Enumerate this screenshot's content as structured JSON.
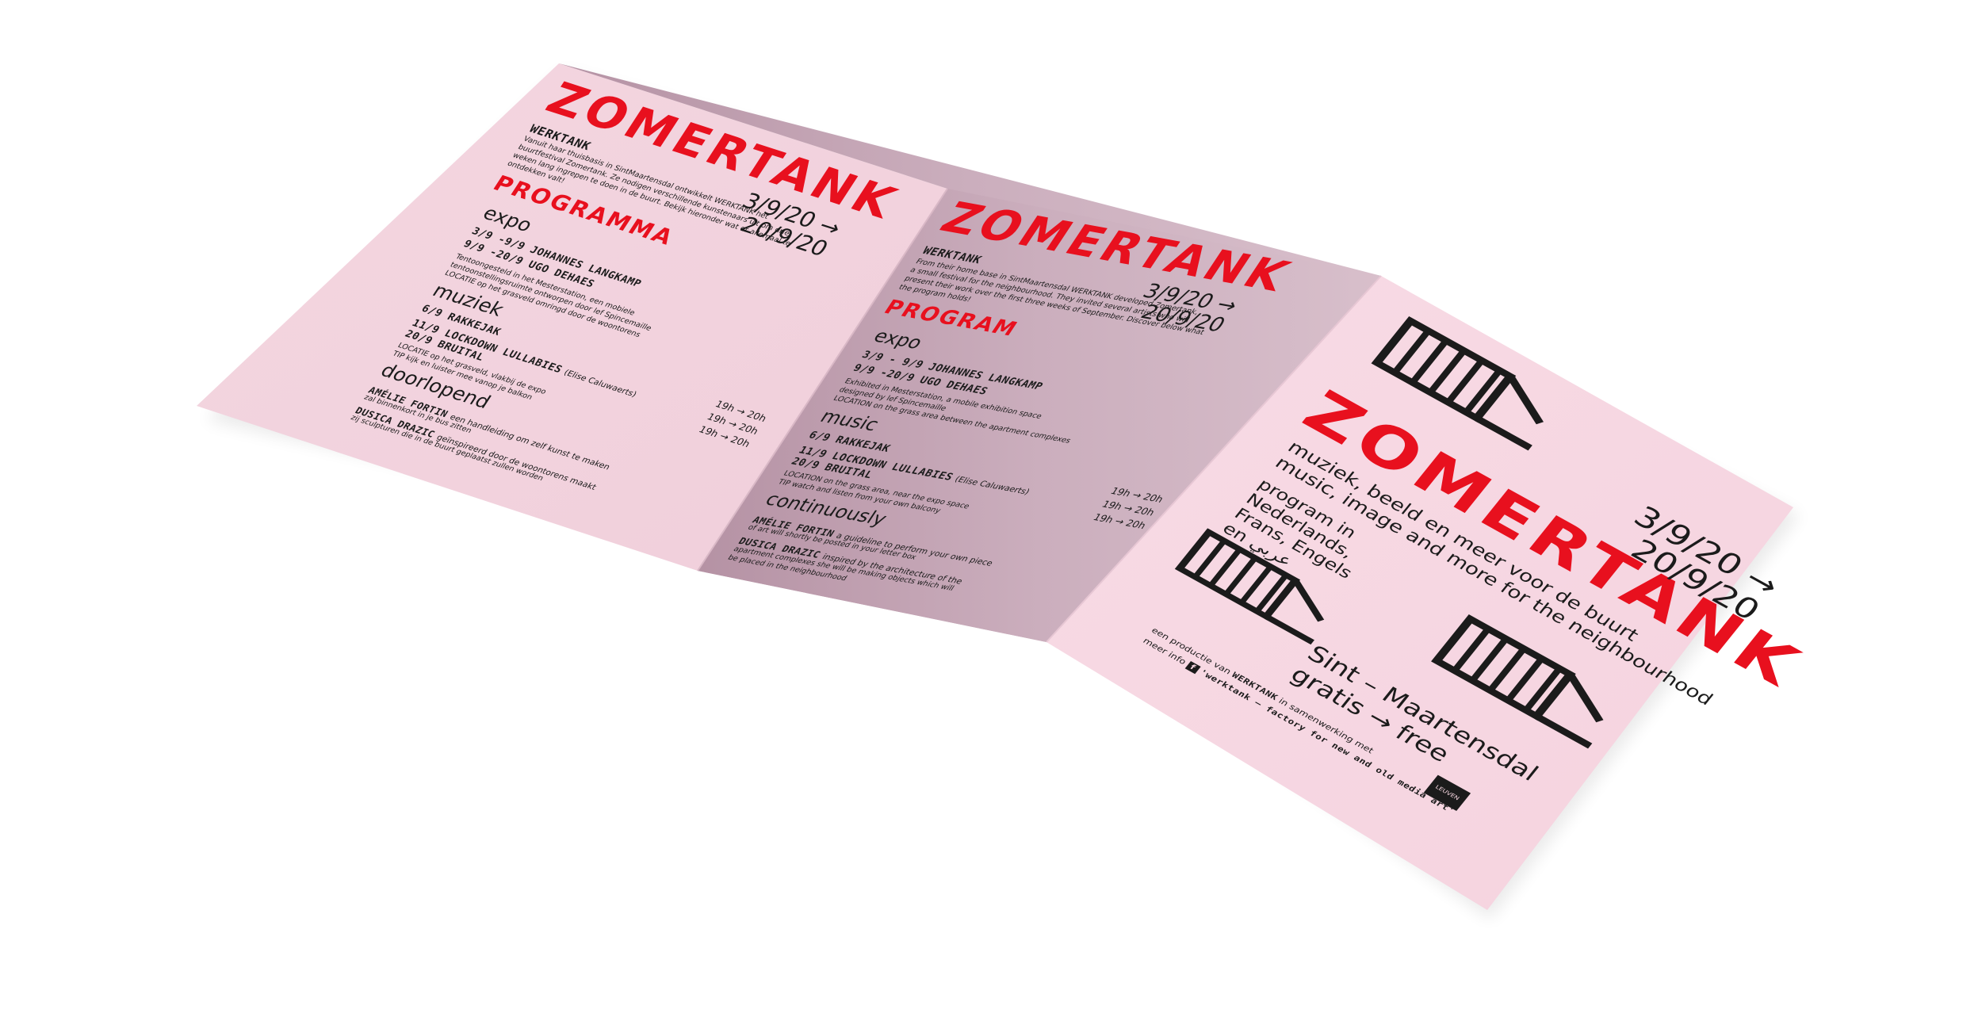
{
  "flyer": {
    "colors": {
      "paper_light": "#f6d6e0",
      "paper_shadow": "#c9a9b7",
      "accent_red": "#e8101e",
      "ink": "#1b1b1b"
    },
    "left_panel": {
      "title": "ZOMERTANK",
      "dates_start": "3/9/20 →",
      "dates_end": "20/9/20",
      "org": "WERKTANK",
      "intro": [
        "Vanuit haar thuisbasis in SintMaartensdal ontwikkelt WERKTANK het",
        "buurtfestival Zomertank. Ze nodigen verschillende kunstenaars uit om drie",
        "weken lang ingrepen te doen in de buurt. Bekijk hieronder wat er allemaal te",
        "ontdekken valt!"
      ],
      "heading": "PROGRAMMA",
      "expo_label": "expo",
      "expo_item": "3/9 -9/9 JOHANNES LANGKAMP",
      "expo_item2": "9/9 -20/9 UGO DEHAES",
      "expo_desc": [
        "Tentoongesteld in het Mesterstation, een mobiele",
        "tentoonstellingsruimte ontworpen door lef Spincemaille",
        "LOCATIE op het grasveld omringd door de woontorens"
      ],
      "music_label": "muziek",
      "music_1": "6/9 RAKKEJAK",
      "music_2": "11/9 LOCKDOWN LULLABIES",
      "music_2_note": "(Elise Caluwaerts)",
      "music_3": "20/9 BRUITAL",
      "music_desc": [
        "LOCATIE op het grasveld, vlakbij de expo",
        "TIP kijk en luister mee vanop je balkon"
      ],
      "times": [
        "19h → 20h",
        "19h → 20h",
        "19h → 20h"
      ],
      "ongoing_label": "doorlopend",
      "ongoing_1": "AMÉLIE FORTIN",
      "ongoing_1_desc": "een handleiding om zelf kunst te maken",
      "ongoing_1_desc2": "zal binnenkort in je bus zitten",
      "ongoing_2": "DUSICA DRAZIC",
      "ongoing_2_desc": "geïnspireerd door de woontorens maakt",
      "ongoing_2_desc2": "zij sculpturen die in de buurt geplaatst zullen worden"
    },
    "middle_panel": {
      "title": "ZOMERTANK",
      "dates_start": "3/9/20 →",
      "dates_end": "20/9/20",
      "org": "WERKTANK",
      "intro": [
        "From their home base in SintMaartensdal WERKTANK developed Zomertank,",
        "a small festival for the neighbourhood. They invited several artists who will",
        "present their work over the first three weeks of September. Discover below what",
        "the program holds!"
      ],
      "heading": "PROGRAM",
      "expo_label": "expo",
      "expo_item": "3/9 - 9/9 JOHANNES LANGKAMP",
      "expo_item2": "9/9 -20/9 UGO DEHAES",
      "expo_desc": [
        "Exhibited in Mesterstation, a mobile exhibition space",
        "designed by lef Spincemaille",
        "LOCATION on the grass area between the apartment complexes"
      ],
      "music_label": "music",
      "music_1": "6/9 RAKKEJAK",
      "music_2": "11/9 LOCKDOWN LULLABIES",
      "music_2_note": "(Elise Caluwaerts)",
      "music_3": "20/9 BRUITAL",
      "music_desc": [
        "LOCATION on the grass area, near the expo space",
        "TIP watch and listen from your own balcony"
      ],
      "times": [
        "19h → 20h",
        "19h → 20h",
        "19h → 20h"
      ],
      "ongoing_label": "continuously",
      "ongoing_1": "AMÉLIE FORTIN",
      "ongoing_1_desc": "a guideline to perform your own piece",
      "ongoing_1_desc2": "of art will shortly be posted in your letter box",
      "ongoing_2": "DUSICA DRAZIC",
      "ongoing_2_desc": "inspired by the architecture of the",
      "ongoing_2_desc2": "apartment complexes she will be making objects which will",
      "ongoing_2_desc3": "be placed in the neighbourhood"
    },
    "right_panel": {
      "title": "ZOMERTANK",
      "dates_start": "3/9/20 →",
      "dates_end": "20/9/20",
      "tagline_nl": "muziek, beeld en meer voor de buurt",
      "tagline_en": "music, image and more for the neighbourhood",
      "languages": [
        "program in",
        "Nederlands,",
        "Frans, Engels",
        "en عربي"
      ],
      "location": "Sint – Maartensdal",
      "price": "gratis → free",
      "credit_prefix": "een productie van",
      "credit_org": "WERKTANK",
      "credit_suffix": "in samenwerking met",
      "info_prefix": "meer info",
      "info_text": "'werktank – factory for new and old media art'",
      "partner_logo": "LEUVEN",
      "icons": [
        "chair-icon",
        "facebook-icon"
      ]
    }
  }
}
